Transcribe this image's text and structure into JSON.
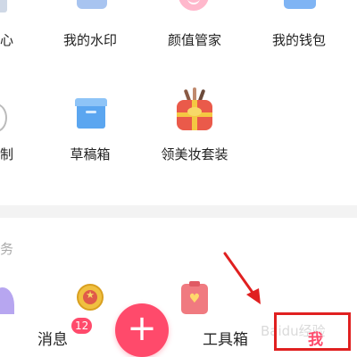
{
  "grid_row1": {
    "item_left_partial": "心",
    "item_watermark": "我的水印",
    "item_beauty_manager": "颜值管家",
    "item_wallet": "我的钱包"
  },
  "grid_row2": {
    "item_left_partial": "制",
    "item_drafts": "草稿箱",
    "item_makeup": "领美妆套装"
  },
  "section3": {
    "label_partial": "务"
  },
  "bottom_nav": {
    "messages": "消息",
    "messages_badge": "12",
    "plus": "+",
    "toolbox": "工具箱",
    "me": "我"
  },
  "watermark_text": "Baidu经验",
  "colors": {
    "accent": "#ff4a6b",
    "annotation_red": "#e02020"
  },
  "icons": [
    "watermark-icon",
    "beauty-icon",
    "wallet-icon",
    "drafts-box-icon",
    "makeup-gift-icon",
    "medal-icon",
    "clipboard-heart-icon",
    "plus-icon",
    "arrow-annotation"
  ]
}
